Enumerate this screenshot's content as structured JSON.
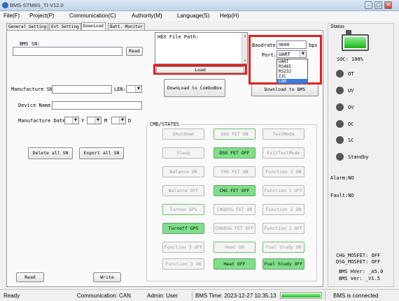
{
  "window": {
    "title": "BMS-STM8S_TI-V12.0",
    "btn_min": "–",
    "btn_max": "□",
    "btn_close": "✕"
  },
  "menu": [
    "File(F)",
    "Project(P)",
    "Communication(C)",
    "Authority(M)",
    "Language(S)",
    "Help(H)"
  ],
  "tabs": [
    "General Setting",
    "Ext Setting",
    "DownLoad",
    "Batt. Monitor"
  ],
  "active_tab": "DownLoad",
  "left": {
    "bms_sn_label": "BMS SN:",
    "bms_sn_value": "",
    "read_label": "Read",
    "manufacture_sn_label": "Manufacture SN:",
    "len_label": "LEN:",
    "device_name_label": "Device Name:",
    "manufacture_date_label": "Manufacture Date:",
    "y_label": "Y",
    "m_label": "M",
    "d_label": "D",
    "delete_all_sn": "Delete all SN",
    "export_all_sn": "Export all SN",
    "read_bottom": "Read",
    "write_bottom": "Write"
  },
  "hex": {
    "label": "HEX File Path:",
    "load": "Load",
    "download_combo": "DownLoad to ComboBox",
    "download_bms": "Download to BMS"
  },
  "port": {
    "baudrate_label": "Baudrate:",
    "baudrate_value": "9600",
    "bps_label": "bps",
    "port_label": "Port:",
    "port_value": "UART",
    "options": [
      "UART",
      "RS485",
      "RS232",
      "I2C",
      "CAN"
    ],
    "highlighted": "CAN"
  },
  "cmd": {
    "title": "CMD/STATES",
    "rows": [
      [
        {
          "label": "Shutdown",
          "state": "disabled"
        },
        {
          "label": "DSG FET ON",
          "state": "border"
        },
        {
          "label": "TestMode",
          "state": "disabled"
        }
      ],
      [
        {
          "label": "Sleep",
          "state": "disabled"
        },
        {
          "label": "DSG FET OFF",
          "state": "green"
        },
        {
          "label": "ExitTestMode",
          "state": "disabled"
        }
      ],
      [
        {
          "label": "Balance ON",
          "state": "disabled"
        },
        {
          "label": "CHG FET ON",
          "state": "disabled"
        },
        {
          "label": "Function 1  ON",
          "state": "disabled"
        }
      ],
      [
        {
          "label": "Balance OFF",
          "state": "disabled"
        },
        {
          "label": "CHG FET OFF",
          "state": "green"
        },
        {
          "label": "Function 1  OFF",
          "state": "disabled"
        }
      ],
      [
        {
          "label": "Turnon GPS",
          "state": "border"
        },
        {
          "label": "CHGDSG FET ON",
          "state": "disabled"
        },
        {
          "label": "Function 2  ON",
          "state": "disabled"
        }
      ],
      [
        {
          "label": "Turnoff GPS",
          "state": "green"
        },
        {
          "label": "CHGDSG FET OFF",
          "state": "disabled"
        },
        {
          "label": "Function 2  OFF",
          "state": "disabled"
        }
      ],
      [
        {
          "label": "Function 3  OFF",
          "state": "disabled"
        },
        {
          "label": "Heat ON",
          "state": "border"
        },
        {
          "label": "Fuel Study ON",
          "state": "border"
        }
      ],
      [
        {
          "label": "Function 3  ON",
          "state": "disabled"
        },
        {
          "label": "Heat OFF",
          "state": "green"
        },
        {
          "label": "Fuel Study OFF",
          "state": "green"
        }
      ]
    ]
  },
  "status": {
    "title": "Status",
    "soc_label": "SOC:",
    "soc_value": "100%",
    "soc_fraction": 1.0,
    "leds": [
      "OT",
      "UV",
      "OV",
      "OC",
      "SC",
      "Standby"
    ],
    "alarm": "Alarm:NO",
    "fault": "Fault:NO",
    "chg_mosfet": "CHG_MOSFET: OFF",
    "dsg_mosfet": "DSG_MOSFET: OFF",
    "bms_hver": "BMS HVer: _A5.0",
    "bms_ver": "BMS Ver: _V1.5"
  },
  "statusbar": {
    "ready": "Ready",
    "communication": "Communication: CAN",
    "admin": "Admin: User",
    "bms_time": "BMS Time: 2023-12-27 10.35.13",
    "progress_fraction": 1.0,
    "connected": "BMS is connected"
  }
}
